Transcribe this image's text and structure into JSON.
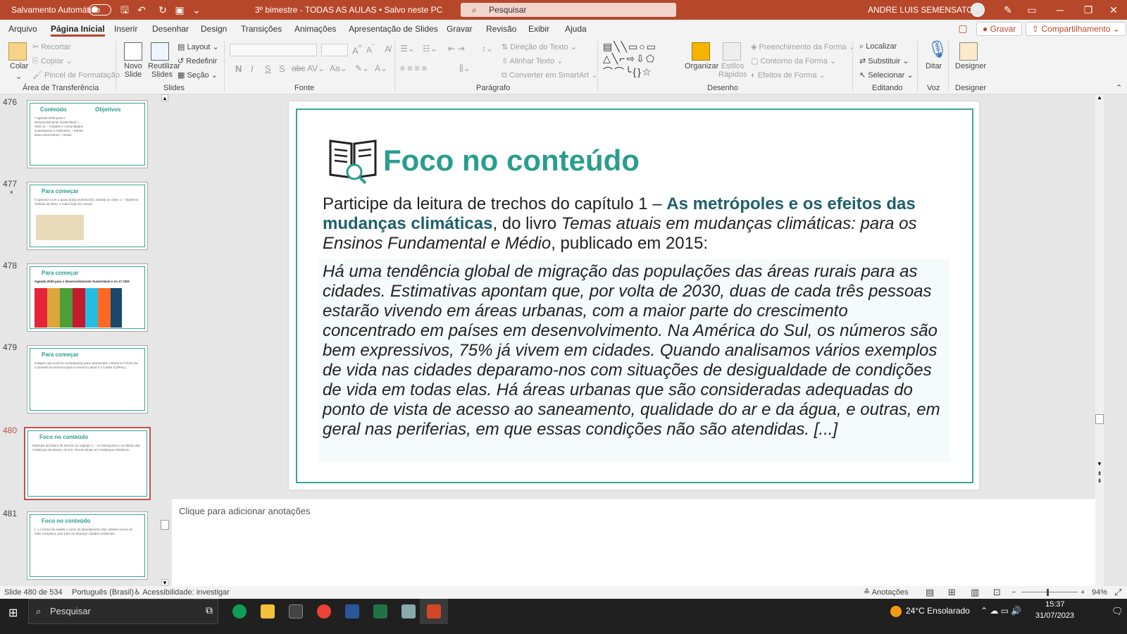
{
  "titlebar": {
    "autosave_label": "Salvamento Automático",
    "doc_title": "3º bimestre - TODAS AS AULAS • Salvo neste PC",
    "search_placeholder": "Pesquisar",
    "user_name": "ANDRE LUIS SEMENSATO"
  },
  "menu": {
    "tabs": [
      "Arquivo",
      "Página Inicial",
      "Inserir",
      "Desenhar",
      "Design",
      "Transições",
      "Animações",
      "Apresentação de Slides",
      "Gravar",
      "Revisão",
      "Exibir",
      "Ajuda"
    ],
    "record_label": "Gravar",
    "share_label": "Compartilhamento"
  },
  "ribbon": {
    "clipboard": {
      "paste": "Colar",
      "cut": "Recortar",
      "copy": "Copiar",
      "format_painter": "Pincel de Formatação",
      "group": "Área de Transferência"
    },
    "slides": {
      "new_slide": "Novo Slide",
      "reuse": "Reutilizar Slides",
      "layout": "Layout",
      "reset": "Redefinir",
      "section": "Seção",
      "group": "Slides"
    },
    "font": {
      "bold": "N",
      "italic": "I",
      "underline": "S",
      "shadow": "S",
      "strike": "abc",
      "group": "Fonte"
    },
    "paragraph": {
      "text_direction": "Direção do Texto",
      "align_text": "Alinhar Texto",
      "smartart": "Converter em SmartArt",
      "group": "Parágrafo"
    },
    "drawing": {
      "arrange": "Organizar",
      "quick_styles": "Estilos Rápidos",
      "fill": "Preenchimento da Forma",
      "outline": "Contorno da Forma",
      "effects": "Efeitos de Forma",
      "group": "Desenho"
    },
    "editing": {
      "find": "Localizar",
      "replace": "Substituir",
      "select": "Selecionar",
      "group": "Editando"
    },
    "voice": {
      "dictate": "Ditar",
      "group": "Voz"
    },
    "designer": {
      "label": "Designer",
      "group": "Designer"
    }
  },
  "thumbnails": [
    {
      "num": "476",
      "title": "Conteúdo",
      "title2": "Objetivos",
      "body": "• Agenda 2030 para o Desenvolvimento Sustentável; • ODS 11 – Cidades e comunidades sustentáveis e resilientes; • Países latino-americanos; • Brasil."
    },
    {
      "num": "477",
      "title": "Para começar",
      "body": "O gancho! Com o apoio do(a) professor(a), assista ao vídeo 1 – Objetivos Globais da ONU: A maior lição do mundo."
    },
    {
      "num": "478",
      "title": "Para começar",
      "body": "Agenda 2030 para o Desenvolvimento Sustentável e os 17 ODS"
    },
    {
      "num": "479",
      "title": "Para começar",
      "body": "Imagine que você foi convidado(a) para representar o Brasil no Fórum da Comissão Econômica para a América Latina e o Caribe (CEPAL)..."
    },
    {
      "num": "480",
      "title": "Foco no conteúdo",
      "body": "Participe da leitura de trechos do capítulo 1 – As metrópoles e os efeitos das mudanças climáticas, do livro Temas atuais em mudanças climáticas..."
    },
    {
      "num": "481",
      "title": "Foco no conteúdo",
      "body": "[...] A forma de avaliar o custo do planejamento das cidades tornou-se mais complexa, pois para se alcançar cidades resilientes..."
    }
  ],
  "slide": {
    "title": "Foco no conteúdo",
    "intro_a": "Participe da leitura de trechos do capítulo 1 – ",
    "intro_bold": "As metrópoles e os efeitos das mudanças climáticas",
    "intro_b": ", do livro ",
    "intro_italic": "Temas atuais em mudanças climáticas: para os Ensinos Fundamental e Médio",
    "intro_c": ", publicado em 2015:",
    "quote": "Há uma tendência global de migração das populações das áreas rurais para as cidades. Estimativas apontam que, por volta de 2030, duas de cada três pessoas estarão vivendo em áreas urbanas, com a maior parte do crescimento concentrado em países em desenvolvimento. Na América do Sul, os números são bem expressivos, 75% já vivem em cidades. Quando analisamos vários exemplos de vida nas cidades deparamo-nos com situações de desigualdade de condições de vida em todas elas. Há áreas urbanas que são consideradas adequadas do ponto de vista de acesso ao saneamento, qualidade do ar e da água, e outras, em geral nas periferias, em que essas condições não são atendidas. [...]"
  },
  "notes_placeholder": "Clique para adicionar anotações",
  "status": {
    "slide_info": "Slide 480 de 534",
    "language": "Português (Brasil)",
    "accessibility": "Acessibilidade: investigar",
    "notes": "Anotações",
    "zoom": "94%"
  },
  "taskbar": {
    "search": "Pesquisar",
    "weather": "24°C  Ensolarado",
    "time": "15:37",
    "date": "31/07/2023"
  },
  "colors": {
    "accent": "#b7472a",
    "teal": "#2a9d8f"
  }
}
